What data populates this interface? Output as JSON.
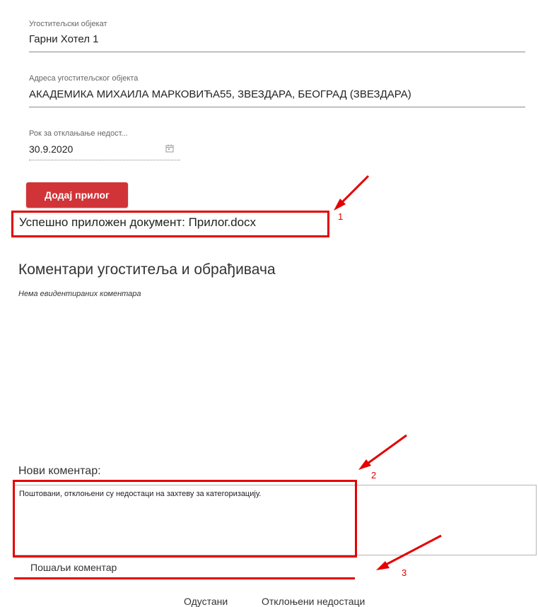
{
  "fields": {
    "facility": {
      "label": "Угоститељски објекат",
      "value": "Гарни Хотел 1"
    },
    "address": {
      "label": "Адреса угоститељског објекта",
      "value": "АКАДЕМИКА МИХАИЛА МАРКОВИЋА55, ЗВЕЗДАРА, БЕОГРАД (ЗВЕЗДАРА)"
    },
    "deadline": {
      "label": "Рок за отклањање недост...",
      "value": "30.9.2020",
      "icon": "calendar-icon"
    }
  },
  "attach_button": {
    "label": "Додај прилог"
  },
  "upload_status": "Успешно приложен документ: Прилог.docx",
  "comments": {
    "title": "Коментари угоститеља и обрађивача",
    "empty_text": "Нема евидентираних коментара"
  },
  "new_comment": {
    "label": "Нови коментар:",
    "value": "Поштовани, отклоњени су недостаци на захтеву за категоризацију."
  },
  "send_button": {
    "label": "Пошаљи коментар"
  },
  "footer": {
    "cancel_label": "Одустани",
    "resolved_label": "Отклоњени недостаци"
  },
  "annotations": {
    "one": "1",
    "two": "2",
    "three": "3"
  },
  "colors": {
    "accent_red": "#d13438",
    "annotation_red": "#e30000"
  }
}
